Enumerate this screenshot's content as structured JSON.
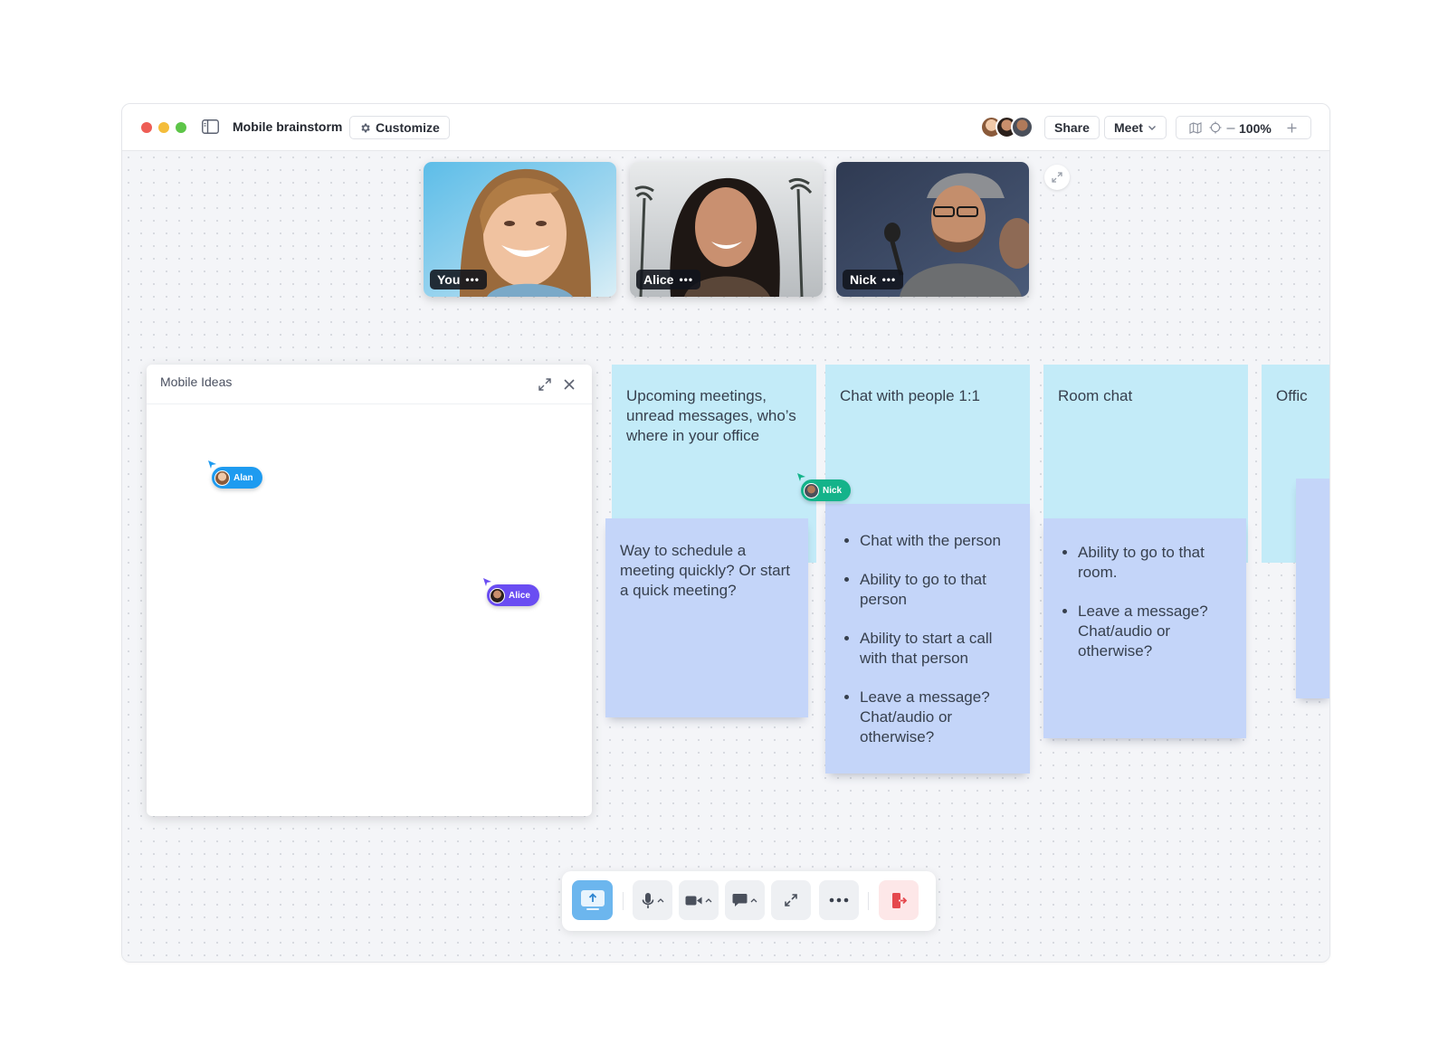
{
  "window": {
    "title": "Mobile brainstorm",
    "customize_label": "Customize",
    "share_label": "Share",
    "meet_label": "Meet",
    "zoom_level": "100%"
  },
  "participants": [
    {
      "name": "You"
    },
    {
      "name": "Alice"
    },
    {
      "name": "Nick"
    }
  ],
  "panel": {
    "title": "Mobile Ideas"
  },
  "cursors": {
    "alan": "Alan",
    "alice": "Alice",
    "nick": "Nick"
  },
  "stickies": {
    "col1_header": "Upcoming meetings, unread messages, who’s where in your office",
    "col1_note": "Way to schedule a meeting quickly? Or start a quick meeting?",
    "col2_header": "Chat with people 1:1",
    "col2_items": [
      "Chat with the person",
      "Ability to go to that person",
      "Ability to start a call with that person",
      "Leave a message? Chat/audio or otherwise?"
    ],
    "col3_header": "Room chat",
    "col3_items": [
      "Ability to go to that room.",
      "Leave a message? Chat/audio or otherwise?"
    ],
    "col4_header": "Offic"
  },
  "colors": {
    "accent_blue": "#1e9bf0",
    "alice_purple": "#6a4df2",
    "nick_green": "#14b38a",
    "sticky_cyan": "#c3ebf8",
    "sticky_blue": "#c4d5f9",
    "leave_red": "#e5484d",
    "share_screen_blue": "#6cb6ee"
  },
  "icons": {
    "sidebar_toggle": "sidebar-icon",
    "customize": "gear-icon",
    "meet_dropdown": "chevron-down-icon",
    "map": "map-icon",
    "locate": "target-icon",
    "zoom_out": "minus-icon",
    "zoom_in": "plus-icon",
    "share_screen": "upload-icon",
    "microphone": "microphone-icon",
    "camera": "video-camera-icon",
    "chat": "chat-bubble-icon",
    "fullscreen": "expand-icon",
    "more": "ellipsis-icon",
    "leave": "leave-door-icon"
  }
}
